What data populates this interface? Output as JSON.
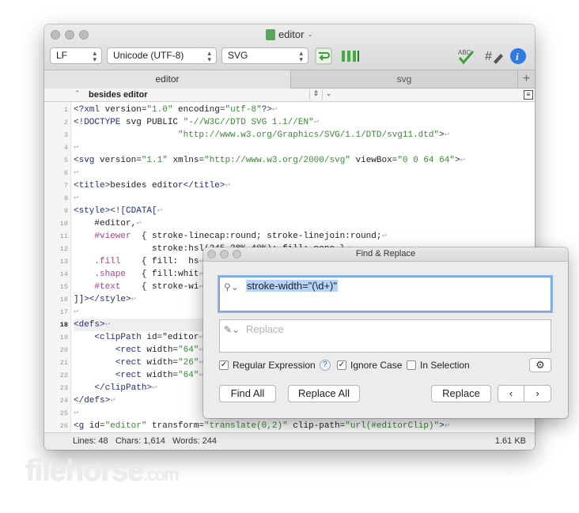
{
  "window": {
    "title": "editor",
    "toolbar": {
      "line_ending": "LF",
      "encoding": "Unicode (UTF-8)",
      "syntax": "SVG"
    },
    "tabs": [
      {
        "label": "editor",
        "active": true
      },
      {
        "label": "svg",
        "active": false
      }
    ],
    "navbar": {
      "title": "besides editor"
    },
    "gutter": {
      "lines": [
        "1",
        "2",
        "3",
        "4",
        "5",
        "6",
        "7",
        "8",
        "9",
        "10",
        "11",
        "12",
        "13",
        "14",
        "15",
        "16",
        "17",
        "18",
        "19",
        "20",
        "21",
        "22",
        "23",
        "24",
        "25",
        "26"
      ]
    },
    "code_lines": [
      "<?xml version=\"1.0\" encoding=\"utf-8\"?>",
      "<!DOCTYPE svg PUBLIC \"-//W3C//DTD SVG 1.1//EN\"",
      "                    \"http://www.w3.org/Graphics/SVG/1.1/DTD/svg11.dtd\">",
      "",
      "<svg version=\"1.1\" xmlns=\"http://www.w3.org/2000/svg\" viewBox=\"0 0 64 64\">",
      "",
      "<title>besides editor</title>",
      "",
      "<style><![CDATA[",
      "    #editor,",
      "    #viewer  { stroke-linecap:round; stroke-linejoin:round;",
      "               stroke:hsl(245,28%,40%); fill: none }",
      "    .fill    { fill:  hs",
      "    .shape   { fill:whit",
      "    #text    { stroke-wi",
      "]]></style>",
      "",
      "<defs>",
      "    <clipPath id=\"editor",
      "        <rect width=\"64\"",
      "        <rect width=\"26\"",
      "        <rect width=\"64\"",
      "    </clipPath>",
      "</defs>",
      "",
      "<g id=\"editor\" transform=\"translate(0,2)\" clip-path=\"url(#editorClip)\">"
    ],
    "status": {
      "lines": "Lines: 48",
      "chars": "Chars: 1,614",
      "words": "Words: 244",
      "size": "1.61 KB"
    }
  },
  "find_panel": {
    "title": "Find & Replace",
    "find_text": "stroke-width=\"(\\d+)\"",
    "replace_placeholder": "Replace",
    "options": {
      "regex": "Regular Expression",
      "ignore_case": "Ignore Case",
      "in_selection": "In Selection"
    },
    "buttons": {
      "find_all": "Find All",
      "replace_all": "Replace All",
      "replace": "Replace",
      "prev": "‹",
      "next": "›"
    }
  },
  "watermark": {
    "brand": "filehorse",
    "suffix": ".com"
  }
}
